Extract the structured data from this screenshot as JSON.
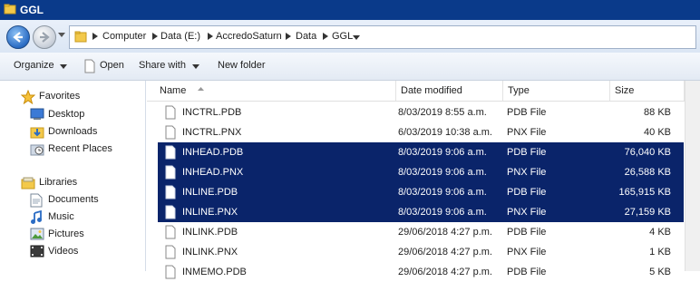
{
  "window": {
    "title": "GGL"
  },
  "address": {
    "crumbs": [
      "Computer",
      "Data (E:)",
      "AccredoSaturn",
      "Data",
      "GGL"
    ]
  },
  "toolbar": {
    "organize": "Organize",
    "open": "Open",
    "share_with": "Share with",
    "new_folder": "New folder"
  },
  "sidebar": {
    "favorites": {
      "label": "Favorites",
      "items": [
        "Desktop",
        "Downloads",
        "Recent Places"
      ]
    },
    "libraries": {
      "label": "Libraries",
      "items": [
        "Documents",
        "Music",
        "Pictures",
        "Videos"
      ]
    }
  },
  "columns": {
    "name": "Name",
    "date": "Date modified",
    "type": "Type",
    "size": "Size"
  },
  "files": [
    {
      "name": "INCTRL.PDB",
      "date": "8/03/2019 8:55 a.m.",
      "type": "PDB File",
      "size": "88 KB",
      "selected": false
    },
    {
      "name": "INCTRL.PNX",
      "date": "6/03/2019 10:38 a.m.",
      "type": "PNX File",
      "size": "40 KB",
      "selected": false
    },
    {
      "name": "INHEAD.PDB",
      "date": "8/03/2019 9:06 a.m.",
      "type": "PDB File",
      "size": "76,040 KB",
      "selected": true
    },
    {
      "name": "INHEAD.PNX",
      "date": "8/03/2019 9:06 a.m.",
      "type": "PNX File",
      "size": "26,588 KB",
      "selected": true
    },
    {
      "name": "INLINE.PDB",
      "date": "8/03/2019 9:06 a.m.",
      "type": "PDB File",
      "size": "165,915 KB",
      "selected": true
    },
    {
      "name": "INLINE.PNX",
      "date": "8/03/2019 9:06 a.m.",
      "type": "PNX File",
      "size": "27,159 KB",
      "selected": true
    },
    {
      "name": "INLINK.PDB",
      "date": "29/06/2018 4:27 p.m.",
      "type": "PDB File",
      "size": "4 KB",
      "selected": false
    },
    {
      "name": "INLINK.PNX",
      "date": "29/06/2018 4:27 p.m.",
      "type": "PNX File",
      "size": "1 KB",
      "selected": false
    },
    {
      "name": "INMEMO.PDB",
      "date": "29/06/2018 4:27 p.m.",
      "type": "PDB File",
      "size": "5 KB",
      "selected": false
    }
  ],
  "colors": {
    "selection": "#0a246a",
    "titlebar": "#0a3a8a"
  }
}
